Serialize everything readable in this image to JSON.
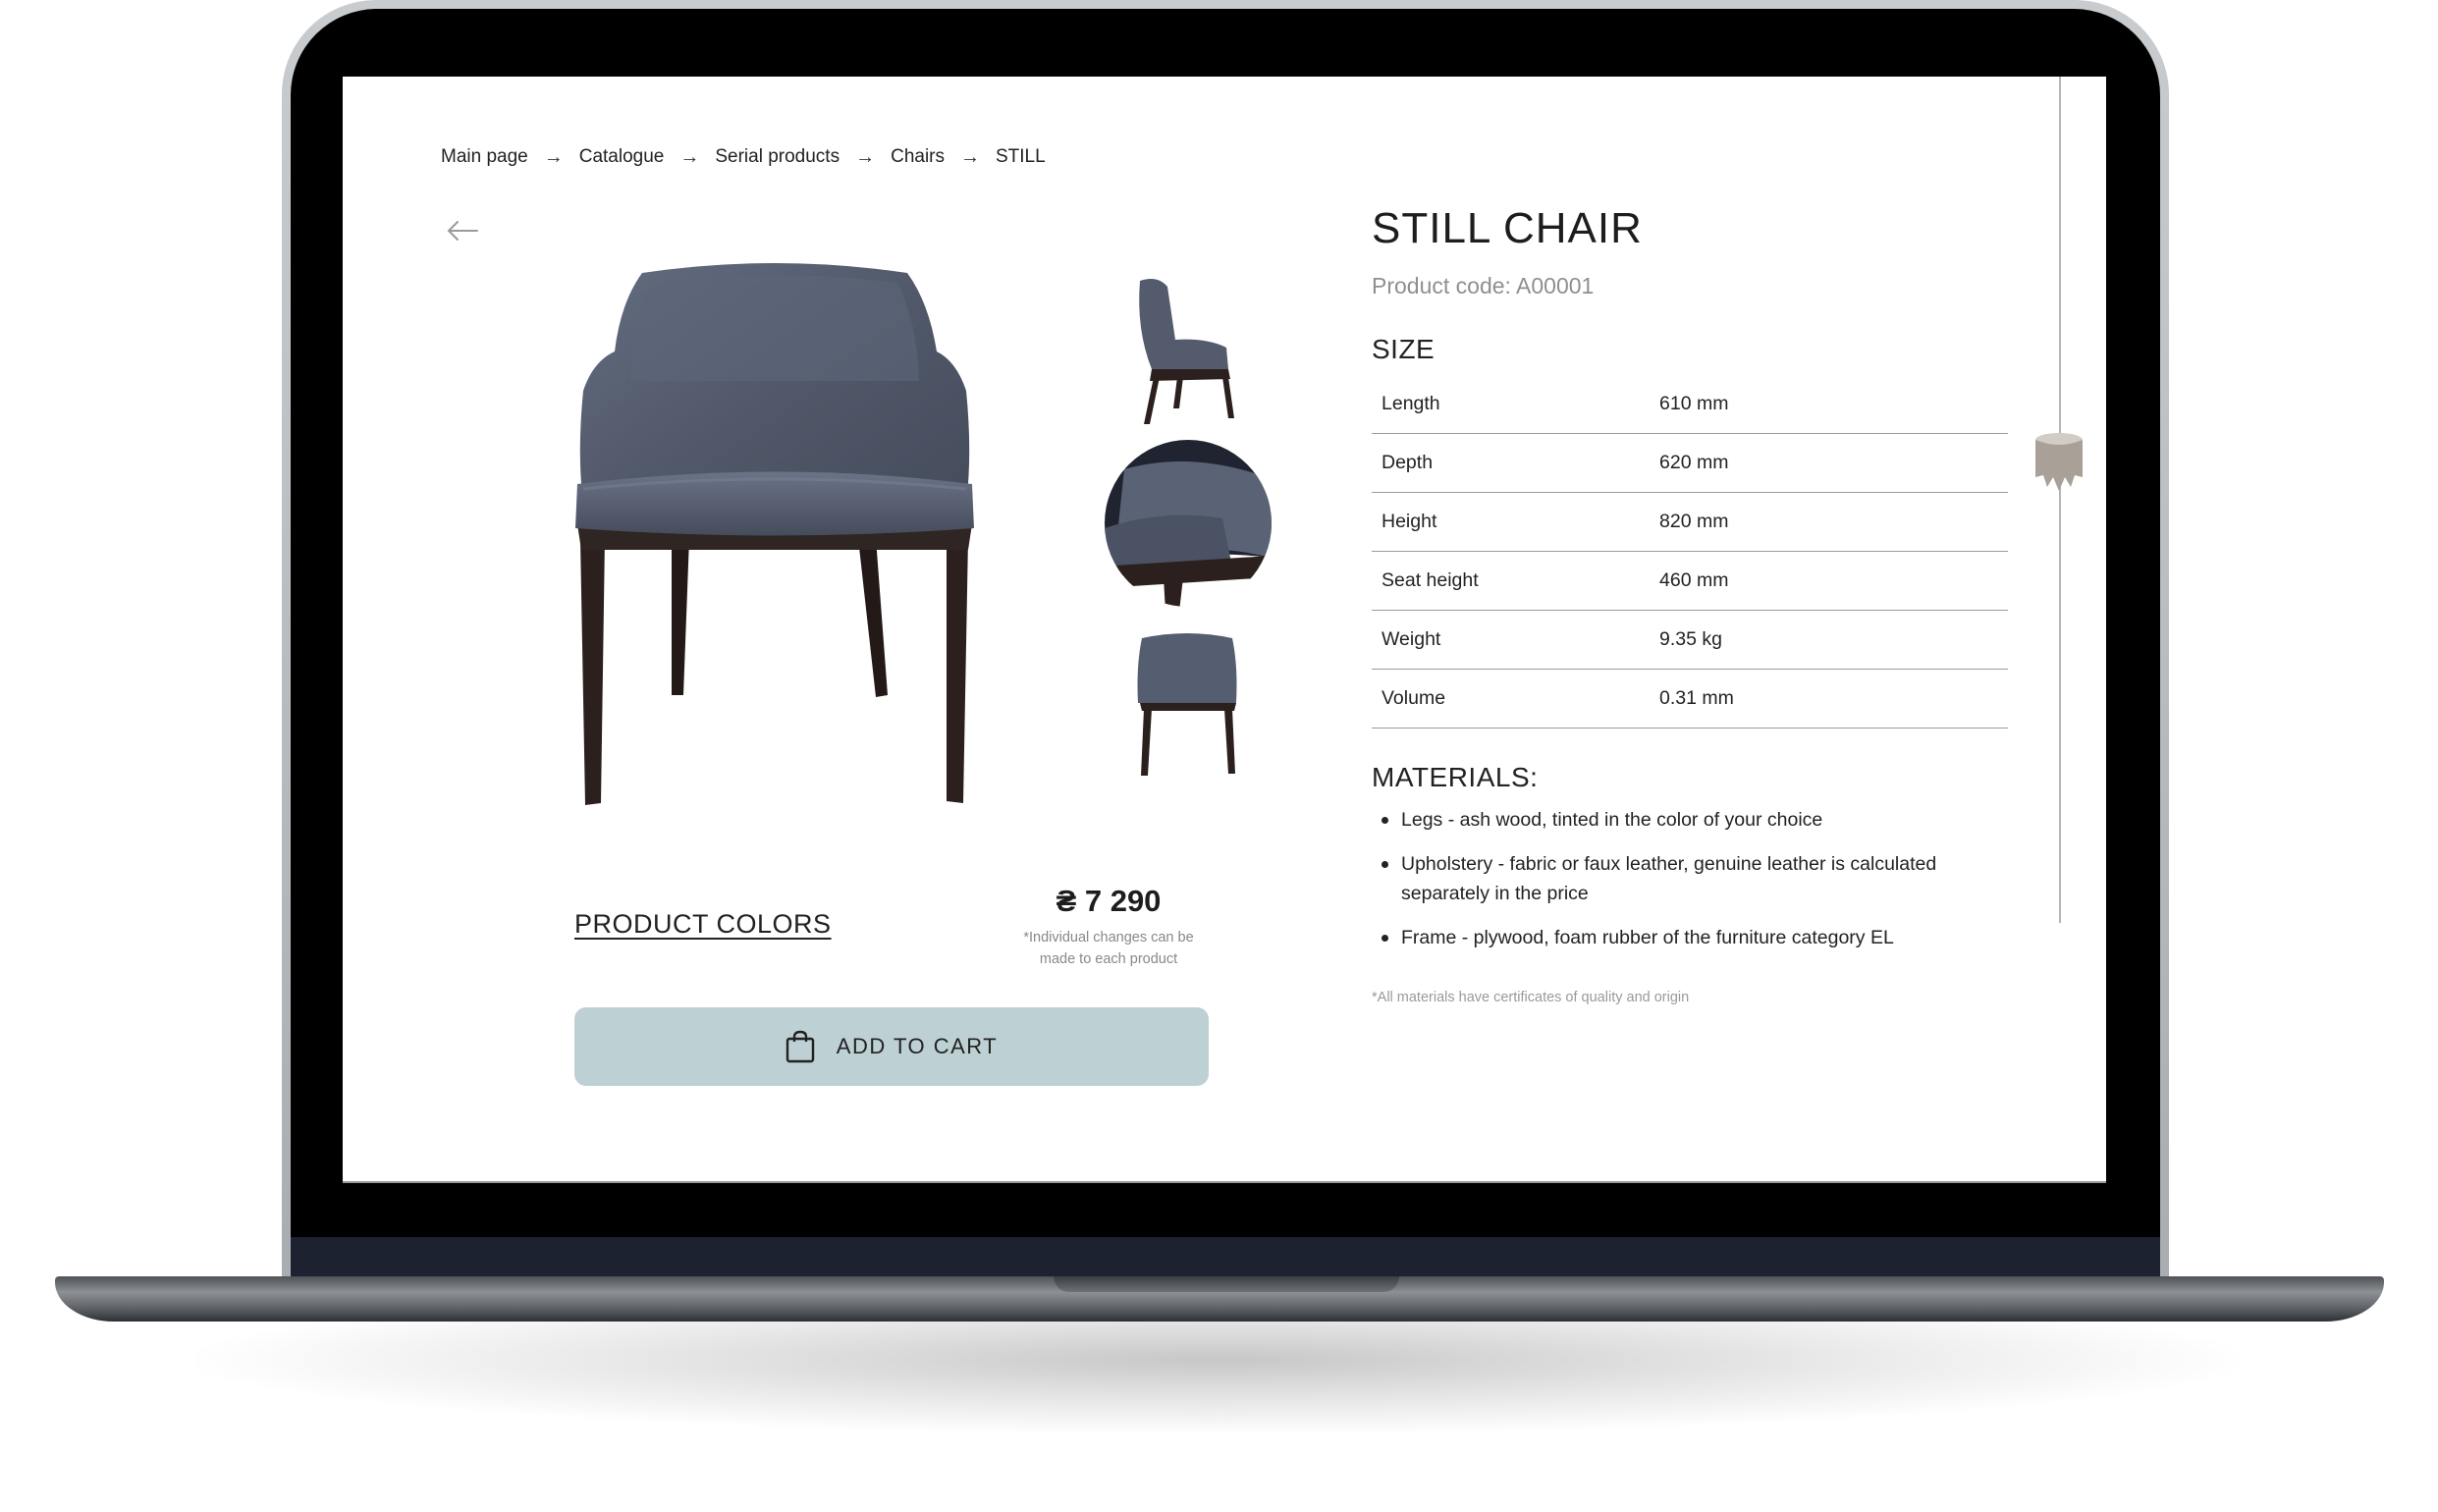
{
  "breadcrumb": {
    "items": [
      "Main page",
      "Catalogue",
      "Serial products",
      "Chairs",
      "STILL"
    ],
    "separator": "→"
  },
  "product": {
    "title": "STILL CHAIR",
    "code": "Product code: A00001",
    "price": "₴ 7 290",
    "price_note": "*Individual changes can be made to each product",
    "colors_link": "PRODUCT COLORS",
    "add_to_cart": "ADD TO CART"
  },
  "size": {
    "heading": "SIZE",
    "rows": [
      {
        "label": "Length",
        "value": "610 mm"
      },
      {
        "label": "Depth",
        "value": "620 mm"
      },
      {
        "label": "Height",
        "value": "820 mm"
      },
      {
        "label": "Seat height",
        "value": "460 mm"
      },
      {
        "label": "Weight",
        "value": "9.35 kg"
      },
      {
        "label": "Volume",
        "value": "0.31 mm"
      }
    ]
  },
  "materials": {
    "heading": "MATERIALS:",
    "items": [
      "Legs - ash wood, tinted in the color of your choice",
      "Upholstery - fabric or faux leather, genuine leather is calculated separately in the price",
      "Frame - plywood, foam rubber of the furniture category EL"
    ],
    "note": "*All materials have certificates of quality and origin"
  },
  "icons": {
    "back": "arrow-left-icon",
    "cart": "shopping-bag-icon",
    "scroll": "stool-scroll-handle-icon"
  },
  "colors": {
    "cart_button": "#bdd0d3",
    "upholstery": "#5c6478",
    "legs": "#2a1f1c",
    "screen_bezel": "#000000"
  }
}
